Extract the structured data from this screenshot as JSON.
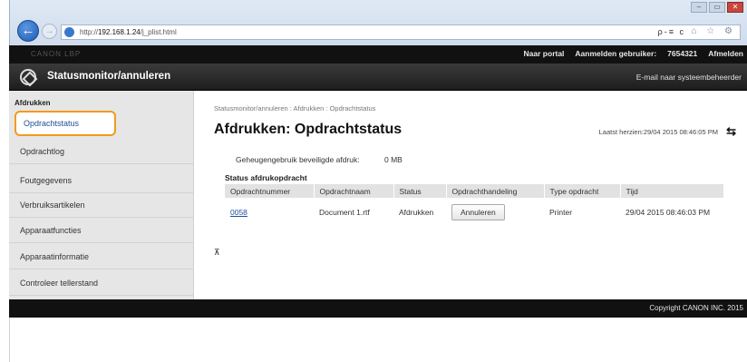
{
  "browser": {
    "url_prefix": "http://",
    "url_host": "192.168.1.24",
    "url_path": "/j_plist.html",
    "tools": "ρ-≡ c",
    "icons": "⌂ ☆ ⚙"
  },
  "window": {
    "minimize": "–",
    "restore": "▭",
    "close": "✕"
  },
  "topbar": {
    "ghost": "CANON  LBP",
    "links": [
      "Naar portal",
      "Aanmelden gebruiker:",
      "7654321",
      "Afmelden"
    ]
  },
  "header": {
    "title": "Statusmonitor/annuleren",
    "mail": "E-mail naar systeembeheerder"
  },
  "sidebar": {
    "heading": "Afdrukken",
    "items": [
      {
        "label": "Opdrachtstatus"
      },
      {
        "label": "Opdrachtlog"
      },
      {
        "label": "Foutgegevens"
      },
      {
        "label": "Verbruiksartikelen"
      },
      {
        "label": "Apparaatfuncties"
      },
      {
        "label": "Apparaatinformatie"
      },
      {
        "label": "Controleer tellerstand"
      }
    ]
  },
  "main": {
    "breadcrumb": "Statusmonitor/annuleren : Afdrukken : Opdrachtstatus",
    "title": "Afdrukken: Opdrachtstatus",
    "updated": "Laatst herzien:29/04 2015 08:46:05 PM",
    "mem_label": "Geheugengebruik beveiligde afdruk:",
    "mem_value": "0 MB",
    "section": "Status afdrukopdracht",
    "table": {
      "headers": [
        "Opdrachtnummer",
        "Opdrachtnaam",
        "Status",
        "Opdrachthandeling",
        "Type opdracht",
        "Tijd"
      ],
      "rows": [
        {
          "number": "0058",
          "name": "Document 1.rtf",
          "status": "Afdrukken",
          "action": "Annuleren",
          "type": "Printer",
          "time": "29/04 2015 08:46:03 PM"
        }
      ]
    }
  },
  "footer": {
    "copyright": "Copyright CANON INC. 2015"
  }
}
